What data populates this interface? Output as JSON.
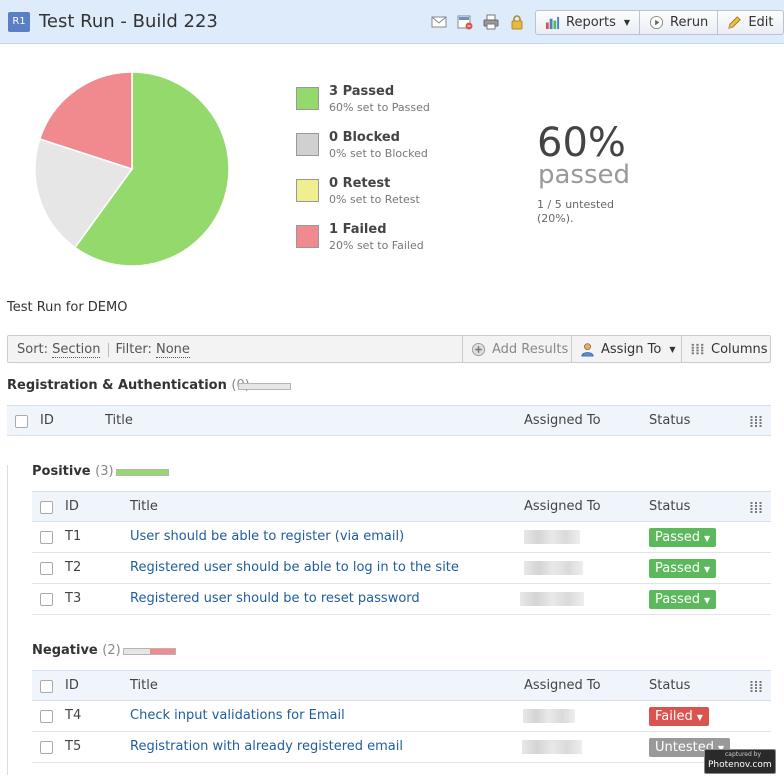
{
  "header": {
    "badge": "R1",
    "title": "Test Run - Build 223",
    "buttons": {
      "reports": "Reports",
      "rerun": "Rerun",
      "edit": "Edit"
    }
  },
  "summary": {
    "legend": [
      {
        "count": "3 Passed",
        "detail": "60% set to Passed",
        "color": "#93d96c"
      },
      {
        "count": "0 Blocked",
        "detail": "0% set to Blocked",
        "color": "#d0d0d0"
      },
      {
        "count": "0 Retest",
        "detail": "0% set to Retest",
        "color": "#f0ef8f"
      },
      {
        "count": "1 Failed",
        "detail": "20% set to Failed",
        "color": "#f08a8f"
      }
    ],
    "pie": [
      {
        "label": "Passed",
        "value": 3,
        "color": "#93d96c"
      },
      {
        "label": "Untested",
        "value": 1,
        "color": "#e6e6e6"
      },
      {
        "label": "Failed",
        "value": 1,
        "color": "#f08a8f"
      }
    ],
    "percent": "60%",
    "percent_word": "passed",
    "untested_note": "1 / 5 untested (20%)."
  },
  "description": "Test Run for DEMO",
  "toolbar": {
    "sort_label": "Sort:",
    "sort_value": "Section",
    "filter_label": "Filter:",
    "filter_value": "None",
    "add_results": "Add Results",
    "assign_to": "Assign To",
    "columns": "Columns"
  },
  "columns": {
    "id": "ID",
    "title": "Title",
    "assigned_to": "Assigned To",
    "status": "Status"
  },
  "section": {
    "name": "Registration & Authentication",
    "count": "(0)"
  },
  "groups": {
    "positive": {
      "name": "Positive",
      "count": "(3)",
      "progress": [
        {
          "value": 1.0,
          "color": "#93d96c"
        }
      ],
      "rows": [
        {
          "id": "T1",
          "title": "User should be able to register (via email)",
          "status": "Passed",
          "status_color": "#5cb85c"
        },
        {
          "id": "T2",
          "title": "Registered user should be able to log in to the site",
          "status": "Passed",
          "status_color": "#5cb85c"
        },
        {
          "id": "T3",
          "title": "Registered user should be to reset password",
          "status": "Passed",
          "status_color": "#5cb85c"
        }
      ]
    },
    "negative": {
      "name": "Negative",
      "count": "(2)",
      "progress": [
        {
          "value": 0.5,
          "color": "#e6e6e6"
        },
        {
          "value": 0.5,
          "color": "#f08a8f"
        }
      ],
      "rows": [
        {
          "id": "T4",
          "title": "Check input validations for Email",
          "status": "Failed",
          "status_color": "#d9534f"
        },
        {
          "id": "T5",
          "title": "Registration with already registered email",
          "status": "Untested",
          "status_color": "#999999"
        }
      ]
    }
  },
  "watermark": {
    "top": "captured by",
    "bottom": "Photenov.com"
  }
}
